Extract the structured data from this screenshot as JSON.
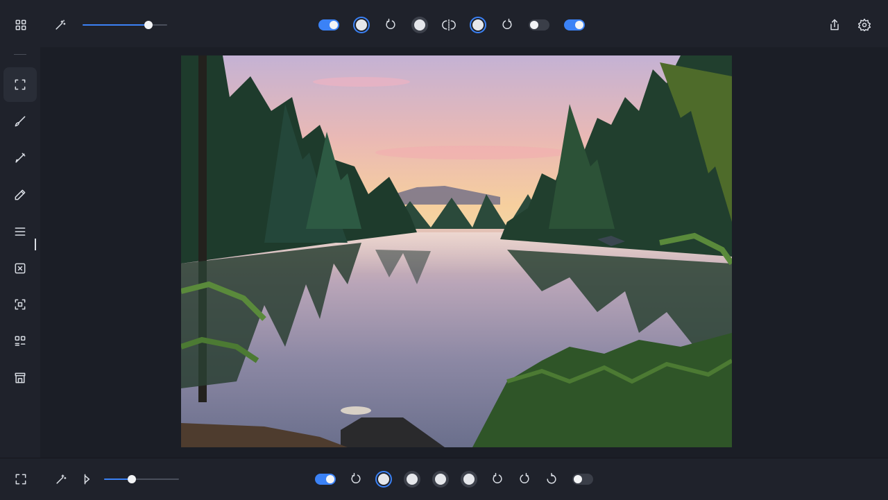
{
  "topbar": {
    "brush_size": 0.78,
    "toggles": [
      {
        "id": "t1",
        "state": "on"
      },
      {
        "id": "t2",
        "state": "off"
      },
      {
        "id": "t3",
        "state": "on"
      }
    ],
    "radios": [
      {
        "id": "r1",
        "selected": true
      },
      {
        "id": "r2",
        "selected": false
      },
      {
        "id": "r3",
        "selected": true
      }
    ],
    "icons": [
      "grid-icon",
      "magic-wand-icon",
      "rotate-left-icon",
      "flip-icon",
      "rotate-right-icon",
      "share-icon",
      "settings-icon"
    ]
  },
  "sidebar": {
    "tools": [
      "crop-frame-icon",
      "brush-icon",
      "pen-icon",
      "pencil-icon",
      "menu-lines-icon",
      "transform-icon",
      "frame-select-icon",
      "layout-icon",
      "storefront-icon"
    ],
    "active": "crop-frame-icon"
  },
  "bottombar": {
    "brush_size": 0.37,
    "toggles": [
      {
        "id": "b1",
        "state": "on"
      },
      {
        "id": "b2",
        "state": "off"
      }
    ],
    "radios": [
      {
        "id": "br1",
        "selected": true
      },
      {
        "id": "br2",
        "selected": false
      },
      {
        "id": "br3",
        "selected": false
      },
      {
        "id": "br4",
        "selected": false
      }
    ],
    "icons": [
      "fullscreen-icon",
      "magic-wand-icon",
      "cursor-flip-icon",
      "rotate-icon",
      "rotate-left-icon",
      "rotate-right-icon",
      "rotate-ccw-icon"
    ]
  },
  "canvas": {
    "image_subject": "lake-forest-sunrise",
    "colors": {
      "sky_top": "#c9b7d6",
      "sky_glow": "#f5c49a",
      "tree_dark": "#1c3a2a",
      "water": "#7b7fa0"
    }
  },
  "accent_color": "#3b82f6"
}
